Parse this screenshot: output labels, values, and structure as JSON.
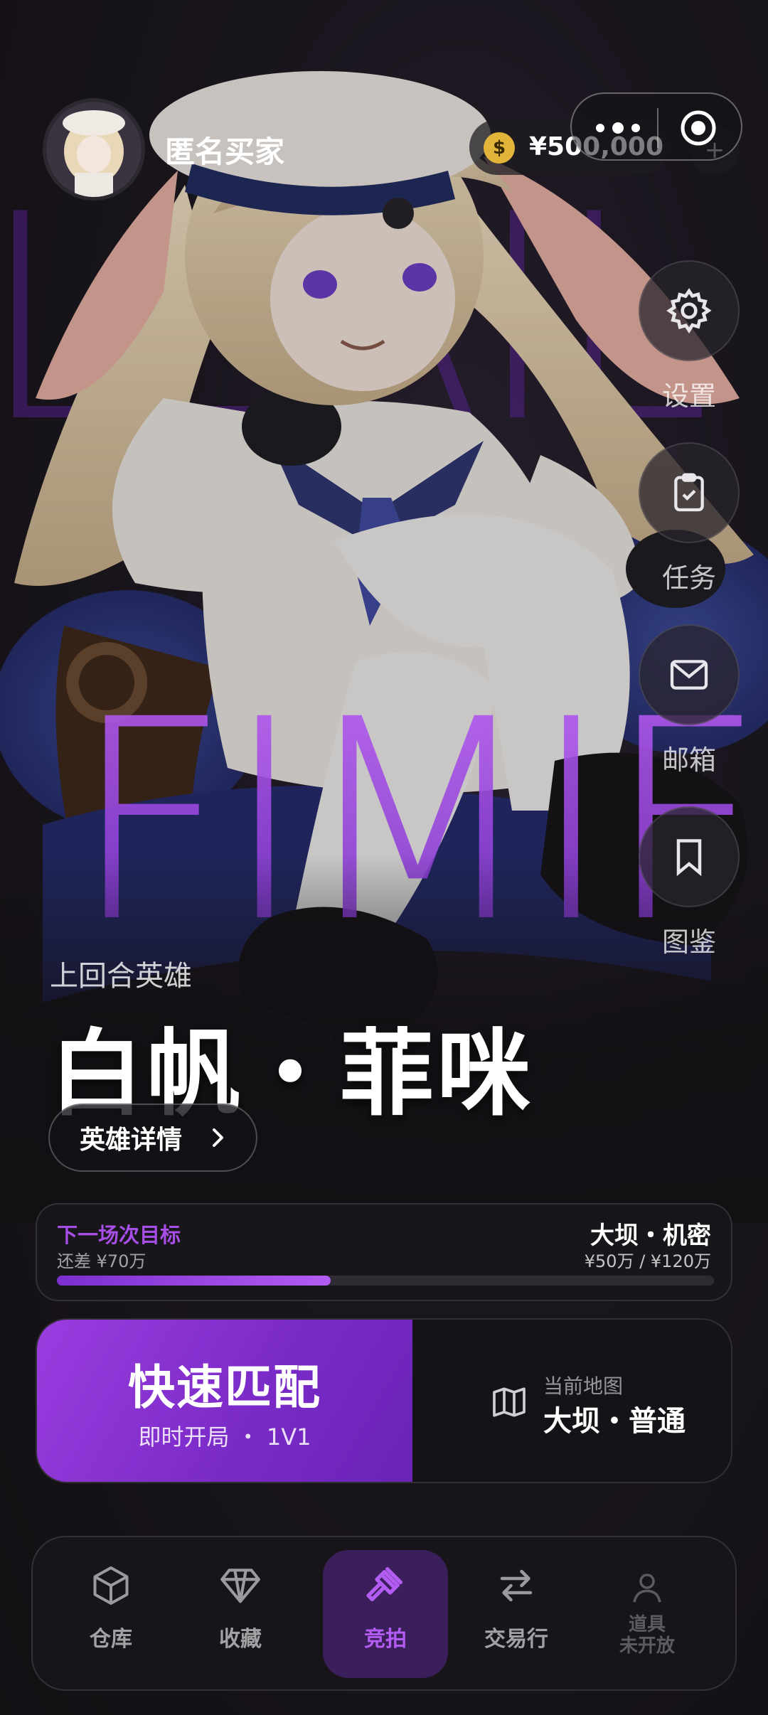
{
  "user": {
    "name": "匿名买家",
    "balance": "¥500,000",
    "add_label": "+"
  },
  "side_menu": [
    {
      "label": "设置",
      "icon": "gear-icon"
    },
    {
      "label": "任务",
      "icon": "clipboard-check-icon"
    },
    {
      "label": "邮箱",
      "icon": "mail-icon"
    },
    {
      "label": "图鉴",
      "icon": "bookmark-icon"
    }
  ],
  "hero": {
    "section_label": "上回合英雄",
    "name": "白帆・菲咪",
    "detail_button": "英雄详情",
    "bg_word_top": "LLAIL",
    "bg_word_main": "FIMIF"
  },
  "goal": {
    "title": "下一场次目标",
    "remaining": "还差 ¥70万",
    "map_name": "大坝・机密",
    "progress_text": "¥50万 / ¥120万",
    "progress": 0.4167
  },
  "match": {
    "quick_title": "快速匹配",
    "quick_sub": "即时开局 ・ 1V1",
    "map_label": "当前地图",
    "map_value": "大坝・普通"
  },
  "nav": [
    {
      "label": "仓库",
      "icon": "box-icon"
    },
    {
      "label": "收藏",
      "icon": "diamond-icon"
    },
    {
      "label": "竞拍",
      "icon": "gavel-icon",
      "active": true
    },
    {
      "label": "交易行",
      "icon": "swap-arrows-icon"
    },
    {
      "label": "道具",
      "sublabel": "未开放",
      "icon": "user-icon",
      "disabled": true
    }
  ],
  "colors": {
    "accent": "#a64ee6",
    "accent_dark": "#7b2bc8",
    "background": "#141216"
  }
}
